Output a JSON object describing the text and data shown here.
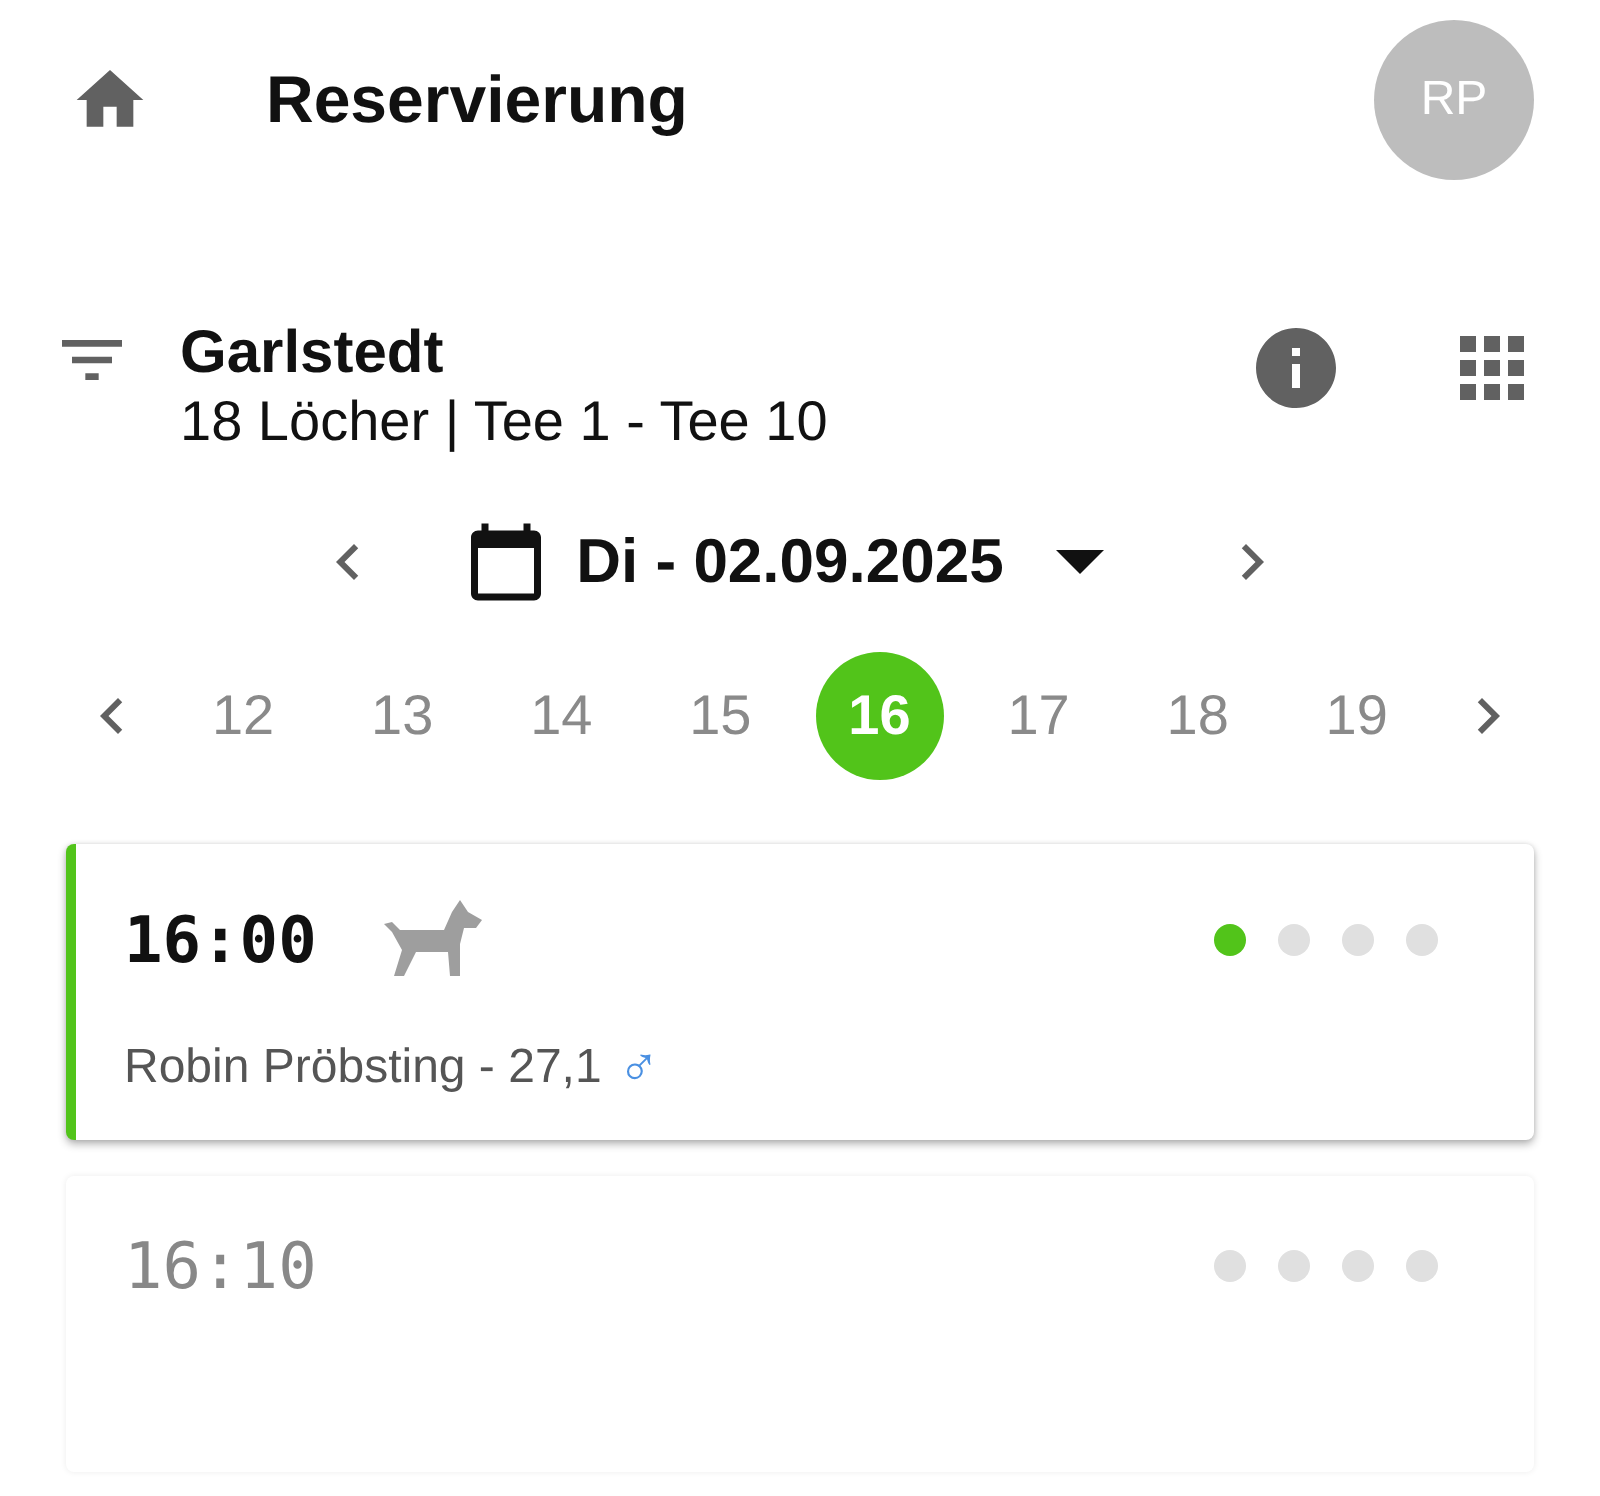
{
  "header": {
    "title": "Reservierung",
    "avatar_initials": "RP"
  },
  "course": {
    "name": "Garlstedt",
    "details": "18 Löcher | Tee 1 - Tee 10"
  },
  "date": {
    "label": "Di - 02.09.2025"
  },
  "days": [
    {
      "label": "12",
      "selected": false
    },
    {
      "label": "13",
      "selected": false
    },
    {
      "label": "14",
      "selected": false
    },
    {
      "label": "15",
      "selected": false
    },
    {
      "label": "16",
      "selected": true
    },
    {
      "label": "17",
      "selected": false
    },
    {
      "label": "18",
      "selected": false
    },
    {
      "label": "19",
      "selected": false
    }
  ],
  "slots": [
    {
      "time": "16:00",
      "booked": true,
      "dog": true,
      "players": [
        {
          "text": "Robin Pröbsting - 27,1",
          "gender_symbol": "♂"
        }
      ],
      "spots": [
        {
          "taken": true
        },
        {
          "taken": false
        },
        {
          "taken": false
        },
        {
          "taken": false
        }
      ]
    },
    {
      "time": "16:10",
      "booked": false,
      "dog": false,
      "spots": [
        {
          "taken": false
        },
        {
          "taken": false
        },
        {
          "taken": false
        },
        {
          "taken": false
        }
      ]
    }
  ]
}
